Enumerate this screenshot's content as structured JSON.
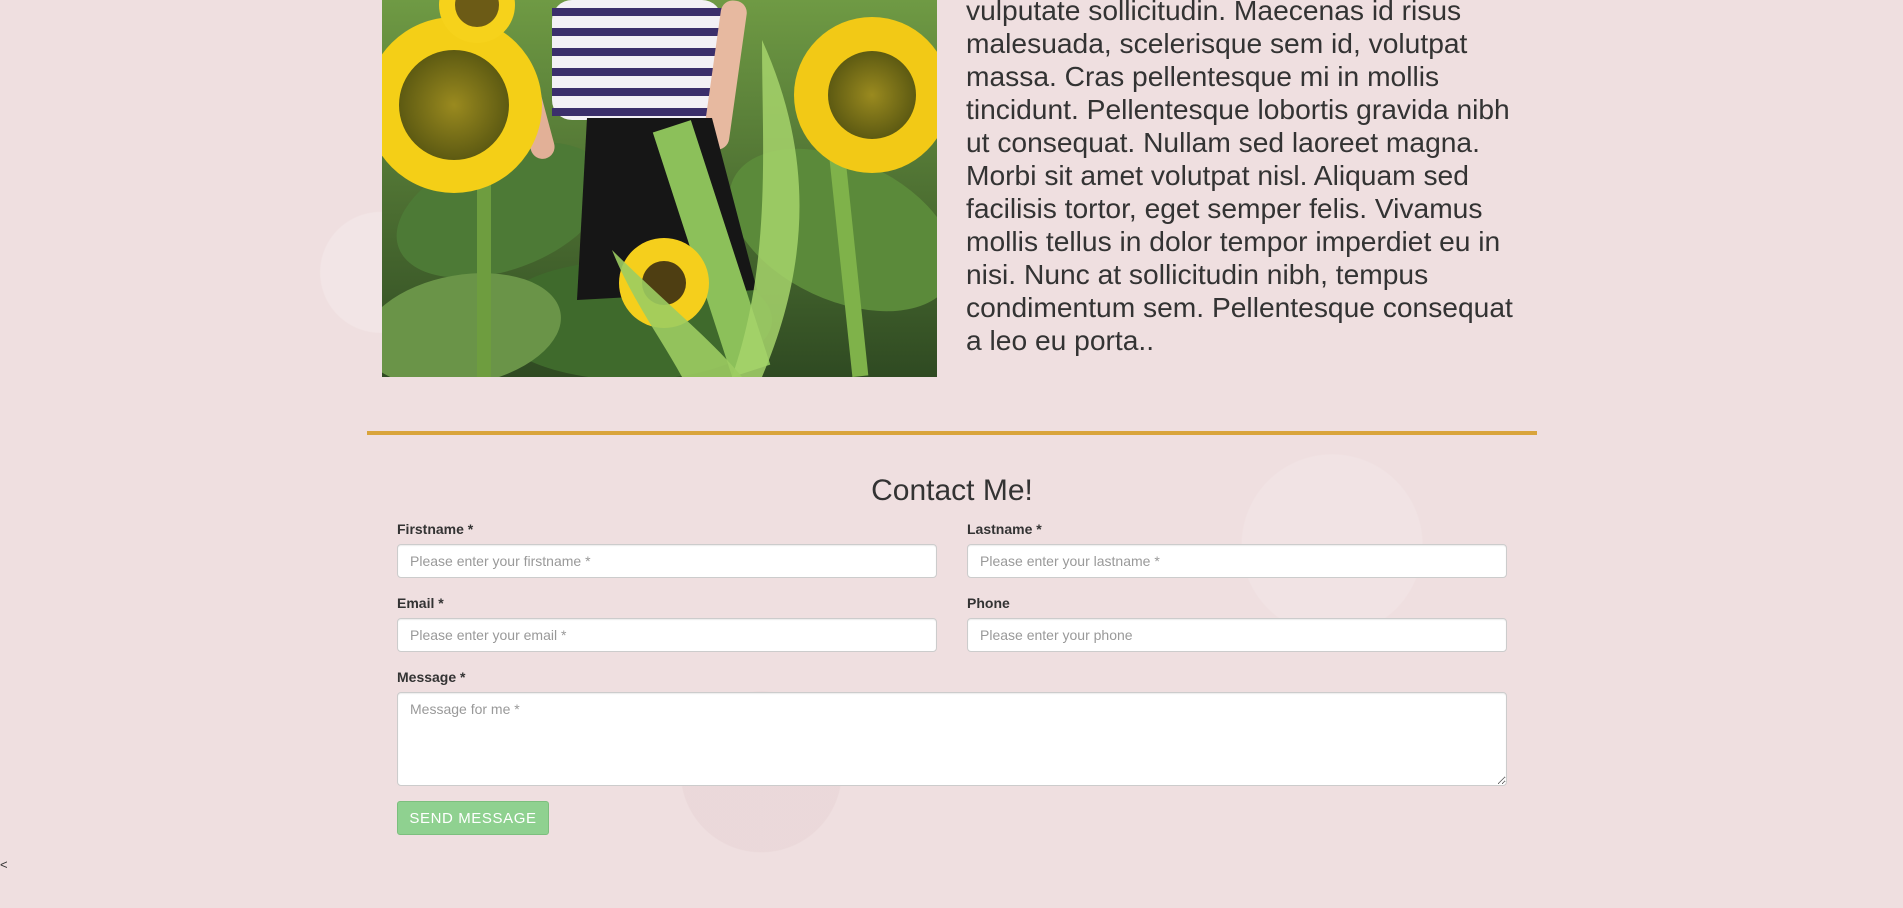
{
  "about": {
    "image_alt": "Woman in striped shirt standing among sunflowers",
    "paragraph": "vulputate sollicitudin. Maecenas id risus malesuada, scelerisque sem id, volutpat massa. Cras pellentesque mi in mollis tincidunt. Pellentesque lobortis gravida nibh ut consequat. Nullam sed laoreet magna. Morbi sit amet volutpat nisl. Aliquam sed facilisis tortor, eget semper felis. Vivamus mollis tellus in dolor tempor imperdiet eu in nisi. Nunc at sollicitudin nibh, tempus condimentum sem. Pellentesque consequat a leo eu porta.."
  },
  "colors": {
    "background": "#efdfe0",
    "divider": "#d9a43b",
    "button": "#8fd190"
  },
  "contact": {
    "title": "Contact Me!",
    "firstname": {
      "label": "Firstname *",
      "placeholder": "Please enter your firstname *",
      "value": ""
    },
    "lastname": {
      "label": "Lastname *",
      "placeholder": "Please enter your lastname *",
      "value": ""
    },
    "email": {
      "label": "Email *",
      "placeholder": "Please enter your email *",
      "value": ""
    },
    "phone": {
      "label": "Phone",
      "placeholder": "Please enter your phone",
      "value": ""
    },
    "message": {
      "label": "Message *",
      "placeholder": "Message for me *",
      "value": ""
    },
    "send_label": "Send message"
  },
  "nav": {
    "back_caret": "<"
  }
}
